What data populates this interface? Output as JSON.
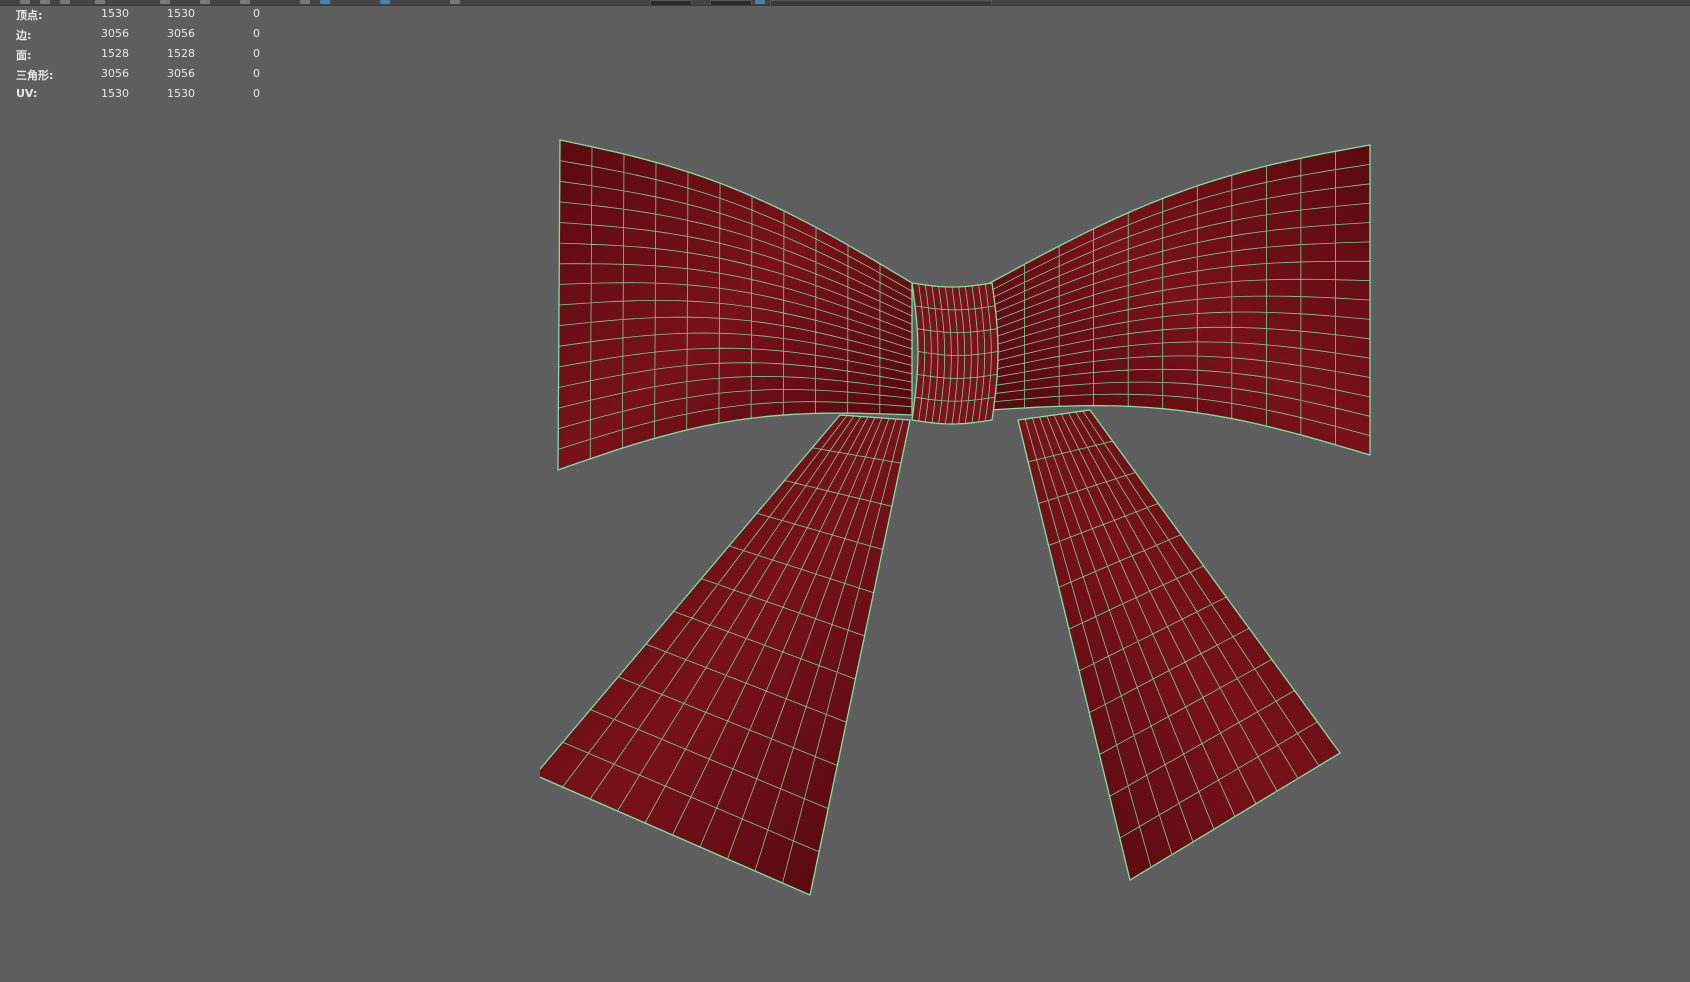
{
  "toolbar": {
    "icons": [
      "select-icon",
      "move-icon",
      "rotate-icon",
      "scale-icon",
      "snap-icon",
      "camera-icon",
      "light-icon",
      "render-icon",
      "wire-icon",
      "shade-icon",
      "grid-icon"
    ],
    "accent_color": "#3d86b4"
  },
  "hud": {
    "rows": [
      {
        "label": "顶点:",
        "values": [
          "1530",
          "1530",
          "0"
        ]
      },
      {
        "label": "边:",
        "values": [
          "3056",
          "3056",
          "0"
        ]
      },
      {
        "label": "面:",
        "values": [
          "1528",
          "1528",
          "0"
        ]
      },
      {
        "label": "三角形:",
        "values": [
          "3056",
          "3056",
          "0"
        ]
      },
      {
        "label": "UV:",
        "values": [
          "1530",
          "1530",
          "0"
        ]
      }
    ]
  },
  "viewport": {
    "background": "#5e5e5e",
    "mesh_color": "#6e0d12",
    "wire_color": "#7be3a2",
    "object": "bow-mesh"
  }
}
